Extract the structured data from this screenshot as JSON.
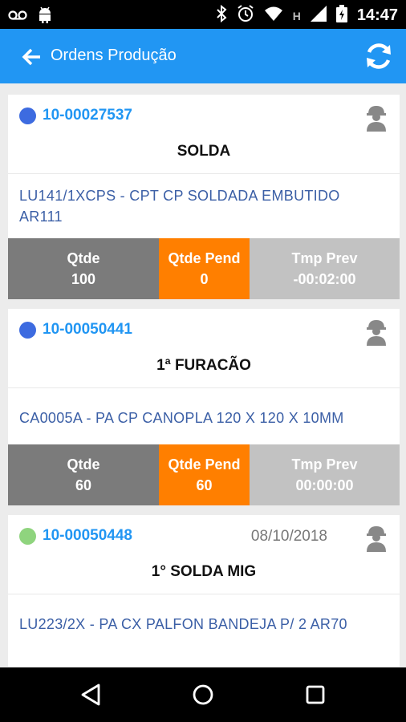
{
  "status_bar": {
    "time": "14:47",
    "network_letter": "H"
  },
  "app_bar": {
    "title": "Ordens Produção"
  },
  "orders": [
    {
      "number": "10-00027537",
      "date": "",
      "status_color": "#3d6be0",
      "operation": "SOLDA",
      "product_line1": "LU141/1XCPS - CPT CP SOLDADA EMBUTIDO",
      "product_line2": "AR111",
      "qtde_label": "Qtde",
      "qtde": "100",
      "pend_label": "Qtde Pend",
      "pend": "0",
      "tmp_label": "Tmp Prev",
      "tmp": "-00:02:00"
    },
    {
      "number": "10-00050441",
      "date": "",
      "status_color": "#3d6be0",
      "operation": "1ª FURACÃO",
      "product_line1": "CA0005A - PA CP CANOPLA 120 X 120 X 10MM",
      "product_line2": "",
      "qtde_label": "Qtde",
      "qtde": "60",
      "pend_label": "Qtde Pend",
      "pend": "60",
      "tmp_label": "Tmp Prev",
      "tmp": "00:00:00"
    },
    {
      "number": "10-00050448",
      "date": "08/10/2018",
      "status_color": "#8fd47e",
      "operation": "1° SOLDA MIG",
      "product_line1": "LU223/2X - PA CX PALFON BANDEJA P/ 2 AR70",
      "product_line2": ""
    }
  ]
}
